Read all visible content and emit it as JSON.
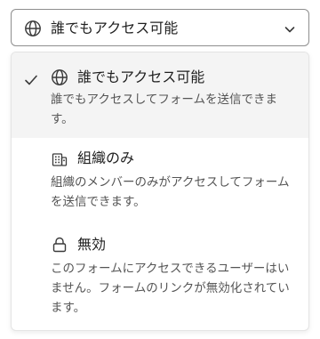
{
  "select": {
    "value": "誰でもアクセス可能",
    "icon": "globe-icon",
    "chevron": "chevron-down-icon"
  },
  "menu": {
    "options": [
      {
        "title": "誰でもアクセス可能",
        "description": "誰でもアクセスしてフォームを送信できます。",
        "icon": "globe-icon",
        "selected": true
      },
      {
        "title": "組織のみ",
        "description": "組織のメンバーのみがアクセスしてフォームを送信できます。",
        "icon": "building-icon",
        "selected": false
      },
      {
        "title": "無効",
        "description": "このフォームにアクセスできるユーザーはいません。フォームのリンクが無効化されています。",
        "icon": "lock-icon",
        "selected": false
      }
    ]
  },
  "colors": {
    "text": "#1f1f1f",
    "secondary_text": "#555555",
    "selected_background": "#f4f4f4",
    "border": "#8e8e8e"
  }
}
